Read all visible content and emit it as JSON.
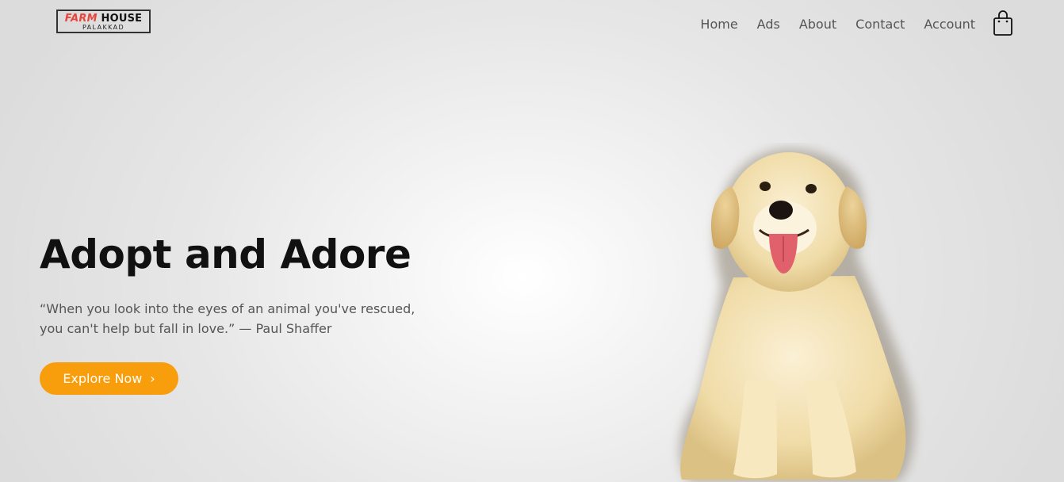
{
  "brand": {
    "logo_word1": "FARM",
    "logo_word2": "HOUSE",
    "logo_sub": "PALAKKAD",
    "accent_red": "#e9453a"
  },
  "nav": {
    "items": [
      {
        "label": "Home"
      },
      {
        "label": "Ads"
      },
      {
        "label": "About"
      },
      {
        "label": "Contact"
      },
      {
        "label": "Account"
      }
    ],
    "cart_icon": "shopping-bag-icon"
  },
  "hero": {
    "title": "Adopt and Adore",
    "quote_line1": "“When you look into the eyes of an animal you've rescued,",
    "quote_line2": "you can't help but fall in love.” — Paul Shaffer",
    "cta_label": "Explore Now",
    "cta_icon": "chevron-right-icon",
    "cta_chevron": "›",
    "cta_color": "#f89d0b",
    "image": "golden-retriever-puppy"
  }
}
